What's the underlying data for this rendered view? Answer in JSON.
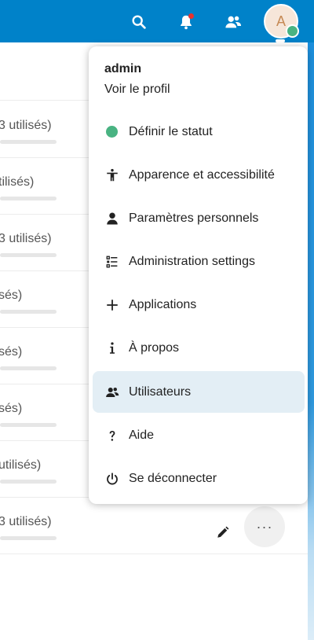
{
  "header": {
    "search_icon": "search-icon",
    "notifications_icon": "bell-icon",
    "contacts_icon": "contacts-icon",
    "avatar_initial": "A",
    "brand_color": "#0082c9",
    "status_color": "#49b382"
  },
  "main": {
    "rows": [
      {
        "text": "3 utilisés)"
      },
      {
        "text": "tilisés)"
      },
      {
        "text": "3 utilisés)"
      },
      {
        "text": "sés)"
      },
      {
        "text": "sés)"
      },
      {
        "text": "sés)"
      },
      {
        "text": "utilisés)"
      },
      {
        "text": "3 utilisés)"
      }
    ],
    "more_label": "···"
  },
  "menu": {
    "username": "admin",
    "view_profile": "Voir le profil",
    "items": [
      {
        "label": "Définir le statut",
        "icon": "status-dot-icon"
      },
      {
        "label": "Apparence et accessibilité",
        "icon": "accessibility-icon"
      },
      {
        "label": "Paramètres personnels",
        "icon": "person-icon"
      },
      {
        "label": "Administration settings",
        "icon": "list-settings-icon"
      },
      {
        "label": "Applications",
        "icon": "plus-icon"
      },
      {
        "label": "À propos",
        "icon": "info-icon"
      },
      {
        "label": "Utilisateurs",
        "icon": "users-icon",
        "active": true
      },
      {
        "label": "Aide",
        "icon": "help-icon"
      },
      {
        "label": "Se déconnecter",
        "icon": "power-icon"
      }
    ]
  }
}
